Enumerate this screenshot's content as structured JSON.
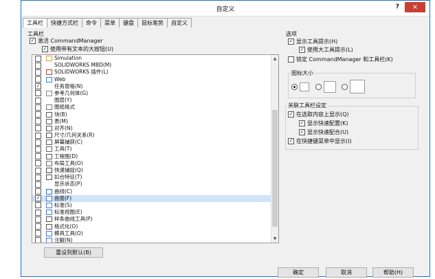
{
  "window": {
    "title": "自定义",
    "help": "?",
    "close": "×"
  },
  "tabs": [
    "工具栏",
    "快捷方式栏",
    "命令",
    "菜单",
    "键盘",
    "鼠标笔势",
    "自定义"
  ],
  "toolbars_group": {
    "title": "工具栏",
    "activate_cm": "激活 CommandManager",
    "use_large_buttons": "使用带有文本的大按钮(U)"
  },
  "toolbar_list": [
    {
      "checked": false,
      "icon": "simulation-icon",
      "label": "Simulation"
    },
    {
      "checked": false,
      "icon": "",
      "label": "SOLIDWORKS MBD(M)"
    },
    {
      "checked": false,
      "icon": "plugin-icon",
      "label": "SOLIDWORKS 插件(L)"
    },
    {
      "checked": false,
      "icon": "web-icon",
      "label": "Web"
    },
    {
      "checked": true,
      "icon": "",
      "label": "任务窗格(N)"
    },
    {
      "checked": false,
      "icon": "ref-geometry-icon",
      "label": "参考几何体(G)"
    },
    {
      "checked": false,
      "icon": "",
      "label": "图层(Y)"
    },
    {
      "checked": false,
      "icon": "sheet-format-icon",
      "label": "图纸格式"
    },
    {
      "checked": false,
      "icon": "block-icon",
      "label": "块(B)"
    },
    {
      "checked": false,
      "icon": "table-icon",
      "label": "表(M)"
    },
    {
      "checked": false,
      "icon": "align-icon",
      "label": "对齐(N)"
    },
    {
      "checked": false,
      "icon": "dimension-icon",
      "label": "尺寸/几何关系(R)"
    },
    {
      "checked": false,
      "icon": "screen-capture-icon",
      "label": "屏幕捕获(C)"
    },
    {
      "checked": false,
      "icon": "tools-icon",
      "label": "工具(T)"
    },
    {
      "checked": false,
      "icon": "drawing-icon",
      "label": "工程图(D)"
    },
    {
      "checked": false,
      "icon": "layout-icon",
      "label": "布局工具(O)"
    },
    {
      "checked": false,
      "icon": "quick-snap-icon",
      "label": "快速捕捉(Q)"
    },
    {
      "checked": false,
      "icon": "fastening-icon",
      "label": "扣合特征(T)"
    },
    {
      "checked": false,
      "icon": "",
      "label": "显示状态(P)"
    },
    {
      "checked": false,
      "icon": "curves-icon",
      "label": "曲线(C)"
    },
    {
      "checked": true,
      "icon": "surfaces-icon",
      "label": "曲面(F)",
      "selected": true
    },
    {
      "checked": false,
      "icon": "standard-icon",
      "label": "标准(S)"
    },
    {
      "checked": false,
      "icon": "standard-views-icon",
      "label": "标准视图(E)"
    },
    {
      "checked": false,
      "icon": "spline-icon",
      "label": "样条曲线工具(P)"
    },
    {
      "checked": false,
      "icon": "format-icon",
      "label": "格式化(O)"
    },
    {
      "checked": false,
      "icon": "mold-icon",
      "label": "模具工具(O)"
    },
    {
      "checked": false,
      "icon": "annotation-icon",
      "label": "注解(N)"
    }
  ],
  "reset_button": "重设到默认(B)",
  "options": {
    "title": "选项",
    "show_tooltips": "显示工具提示(H)",
    "use_large_tooltips": "使用大工具提示(L)",
    "lock_cm": "锁定 CommandManager 和工具栏(K)",
    "icon_size_title": "图标大小"
  },
  "context": {
    "title": "关联工具栏设定",
    "show_in_selection": "在选取内容上显示(Q)",
    "show_quick_config": "显示快速配置(K)",
    "show_quick_mate": "显示快速配合(U)",
    "show_in_shortcut": "在快捷键菜单中显示(I)"
  },
  "footer": {
    "ok": "确定",
    "cancel": "取消",
    "help": "帮助(H)"
  }
}
